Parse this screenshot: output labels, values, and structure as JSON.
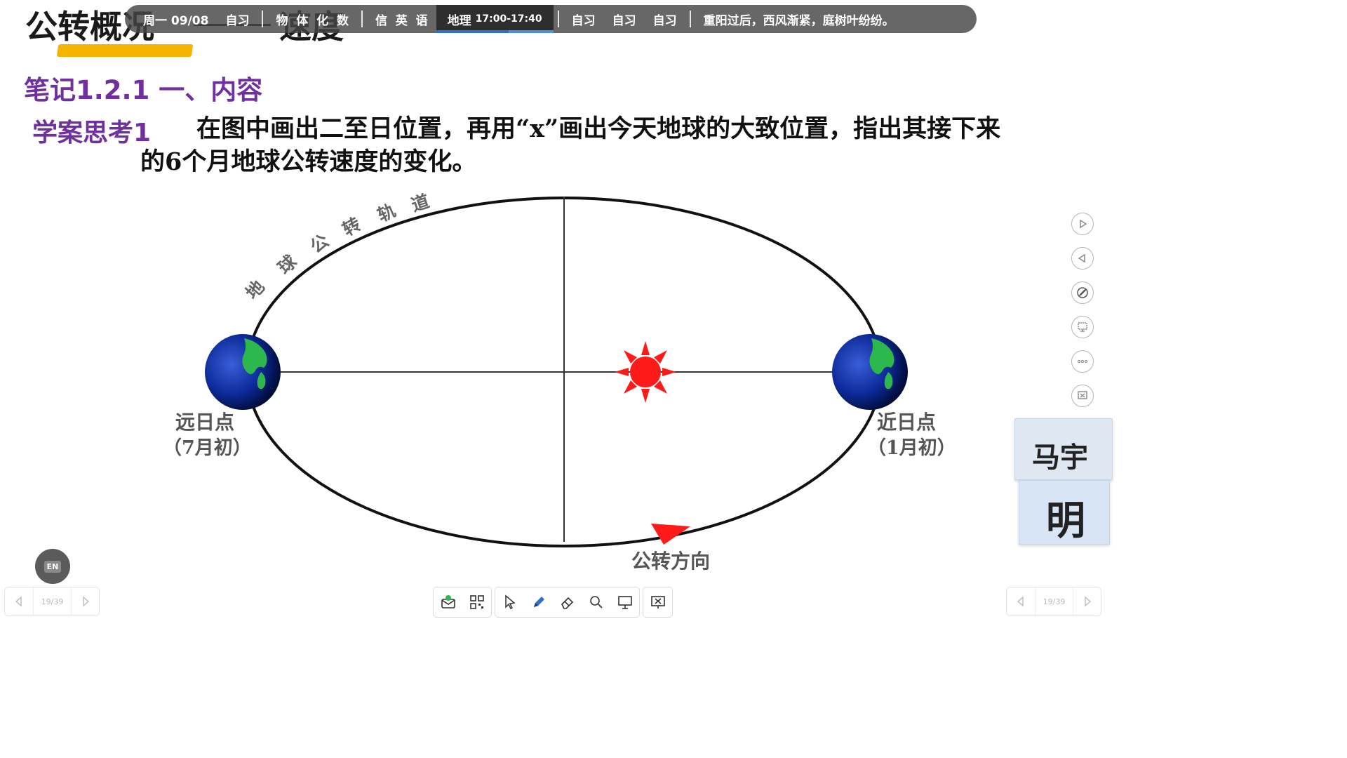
{
  "slide": {
    "title_part1": "公转概况",
    "title_part2": "速度",
    "note_heading": "笔记1.2.1 一、内容",
    "case_label": "学案思考1",
    "question": "在图中画出二至日位置，再用“x”画出今天地球的大致位置，指出其接下来的6个月地球公转速度的变化。"
  },
  "diagram": {
    "orbit_label": [
      "地",
      "球",
      "公",
      "转",
      "轨",
      "道"
    ],
    "aphelion": "远日点",
    "aphelion_sub": "（7月初）",
    "perihelion": "近日点",
    "perihelion_sub": "（1月初）",
    "direction": "公转方向",
    "colors": {
      "sun": "#ff1a1a",
      "earth": "#1030a0",
      "land": "#2db84d",
      "arrow": "#ff1a1a"
    }
  },
  "schedule_bar": {
    "items": [
      {
        "label": "周一 09/08"
      },
      {
        "label": "自习"
      },
      {
        "label": "物  体  化  数"
      },
      {
        "label": "信  英  语"
      }
    ],
    "active": {
      "label": "地理",
      "time": "17:00-17:40"
    },
    "after": [
      {
        "label": "自习"
      },
      {
        "label": "自习"
      },
      {
        "label": "自习"
      }
    ],
    "quote": "重阳过后，西风渐紧，庭树叶纷纷。"
  },
  "side_tools": [
    "play-icon",
    "back-icon",
    "pen-off-icon",
    "screen-icon",
    "more-icon",
    "window-icon"
  ],
  "name_cards": {
    "card1": "马宇",
    "card2": "明"
  },
  "bottom": {
    "en_badge": "EN",
    "page_left": "19/39",
    "page_right": "19/39",
    "tools": [
      "send-icon",
      "qr-icon",
      "select-icon",
      "pen-icon",
      "eraser-icon",
      "search-icon",
      "board-icon",
      "exit-icon"
    ]
  }
}
